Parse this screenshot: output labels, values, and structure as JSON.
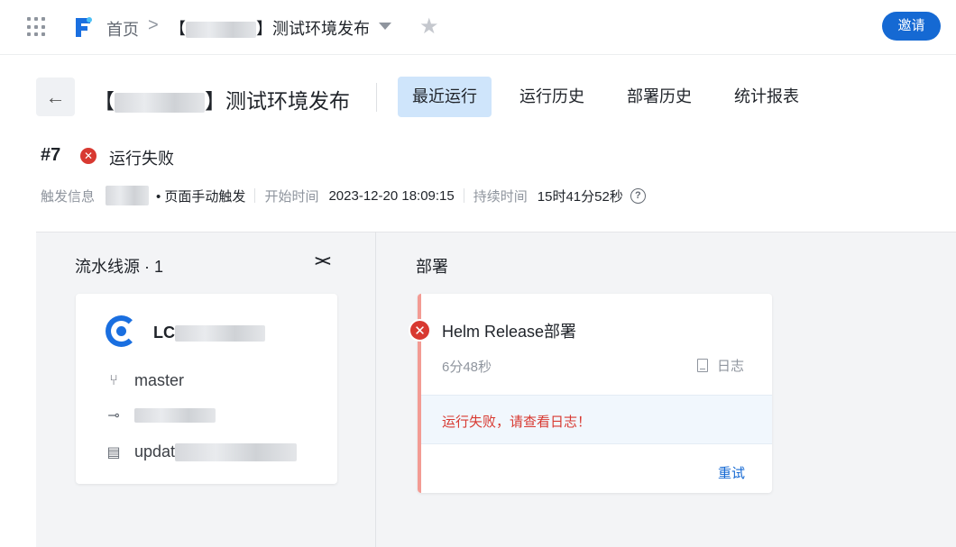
{
  "topbar": {
    "home": "首页",
    "separator": ">",
    "current_project_suffix": "】测试环境发布",
    "current_project_prefix": "【",
    "invite_label": "邀请"
  },
  "header": {
    "title_prefix": "【",
    "title_suffix": "】测试环境发布",
    "tabs": [
      {
        "label": "最近运行",
        "active": true
      },
      {
        "label": "运行历史",
        "active": false
      },
      {
        "label": "部署历史",
        "active": false
      },
      {
        "label": "统计报表",
        "active": false
      }
    ]
  },
  "run": {
    "number": "#7",
    "status": "运行失败",
    "trigger_label": "触发信息",
    "trigger_value": "• 页面手动触发",
    "start_label": "开始时间",
    "start_value": "2023-12-20 18:09:15",
    "duration_label": "持续时间",
    "duration_value": "15时41分52秒",
    "help_icon": "?"
  },
  "source_stage": {
    "title": "流水线源 · 1",
    "collapse_icon": "><",
    "repo_prefix": "LC",
    "branch": "master",
    "commit_message_prefix": "updat"
  },
  "deploy_stage": {
    "title": "部署",
    "job_name": "Helm Release部署",
    "job_duration": "6分48秒",
    "log_label": "日志",
    "error_message": "运行失败，请查看日志！",
    "retry_label": "重试"
  },
  "colors": {
    "accent": "#1569d3",
    "error": "#d83931",
    "active_tab_bg": "#cfe5fb"
  }
}
